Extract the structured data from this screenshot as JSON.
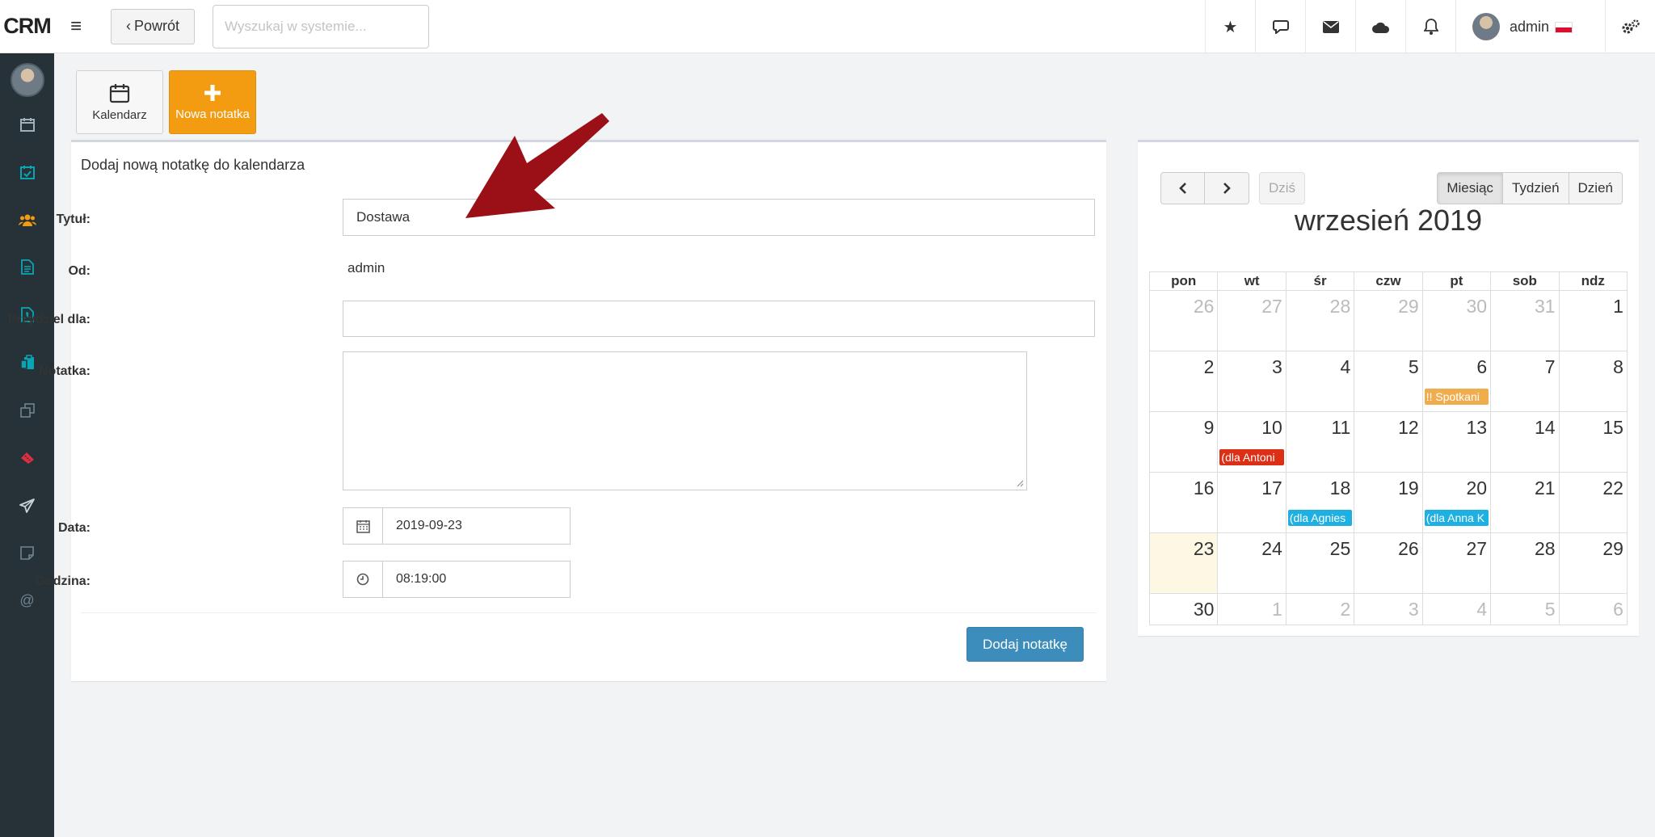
{
  "app": {
    "logo": "CRM",
    "back_label": "Powrót",
    "search_placeholder": "Wyszukaj w systemie...",
    "user_name": "admin"
  },
  "toolbar": {
    "calendar_label": "Kalendarz",
    "new_note_label": "Nowa notatka"
  },
  "form": {
    "title": "Dodaj nową notatkę do kalendarza",
    "title_label": "Tytuł:",
    "title_value": "Dostawa",
    "from_label": "Od:",
    "from_value": "admin",
    "assign_label": "Przydziel dla:",
    "assign_value": "",
    "note_label": "Notatka:",
    "note_value": "",
    "date_label": "Data:",
    "date_value": "2019-09-23",
    "time_label": "Godzina:",
    "time_value": "08:19:00",
    "submit_label": "Dodaj notatkę"
  },
  "calendar": {
    "today_label": "Dziś",
    "views": [
      "Miesiąc",
      "Tydzień",
      "Dzień"
    ],
    "title": "wrzesień 2019",
    "weekdays": [
      "pon",
      "wt",
      "śr",
      "czw",
      "pt",
      "sob",
      "ndz"
    ],
    "weeks": [
      [
        {
          "d": "26",
          "muted": true
        },
        {
          "d": "27",
          "muted": true
        },
        {
          "d": "28",
          "muted": true
        },
        {
          "d": "29",
          "muted": true
        },
        {
          "d": "30",
          "muted": true
        },
        {
          "d": "31",
          "muted": true
        },
        {
          "d": "1"
        }
      ],
      [
        {
          "d": "2"
        },
        {
          "d": "3"
        },
        {
          "d": "4"
        },
        {
          "d": "5"
        },
        {
          "d": "6",
          "event": {
            "text": "!! Spotkani",
            "color": "#f0ad4e"
          }
        },
        {
          "d": "7"
        },
        {
          "d": "8"
        }
      ],
      [
        {
          "d": "9"
        },
        {
          "d": "10",
          "event": {
            "text": "(dla Antoni",
            "color": "#dd2e16"
          }
        },
        {
          "d": "11"
        },
        {
          "d": "12"
        },
        {
          "d": "13"
        },
        {
          "d": "14"
        },
        {
          "d": "15"
        }
      ],
      [
        {
          "d": "16"
        },
        {
          "d": "17"
        },
        {
          "d": "18",
          "event": {
            "text": "(dla Agnies",
            "color": "#1eb0e0"
          }
        },
        {
          "d": "19"
        },
        {
          "d": "20",
          "event": {
            "text": "(dla Anna K",
            "color": "#1eb0e0"
          }
        },
        {
          "d": "21"
        },
        {
          "d": "22"
        }
      ],
      [
        {
          "d": "23",
          "today": true
        },
        {
          "d": "24"
        },
        {
          "d": "25"
        },
        {
          "d": "26"
        },
        {
          "d": "27"
        },
        {
          "d": "28"
        },
        {
          "d": "29"
        }
      ],
      [
        {
          "d": "30"
        },
        {
          "d": "1",
          "muted": true
        },
        {
          "d": "2",
          "muted": true
        },
        {
          "d": "3",
          "muted": true
        },
        {
          "d": "4",
          "muted": true
        },
        {
          "d": "5",
          "muted": true
        },
        {
          "d": "6",
          "muted": true
        }
      ]
    ]
  },
  "colors": {
    "sidebar_bg": "#263238",
    "accent_orange": "#f39c12",
    "primary_blue": "#3c8dbc",
    "sidebar_icon": "#0aa5b3",
    "arrow": "#9b0f17"
  }
}
